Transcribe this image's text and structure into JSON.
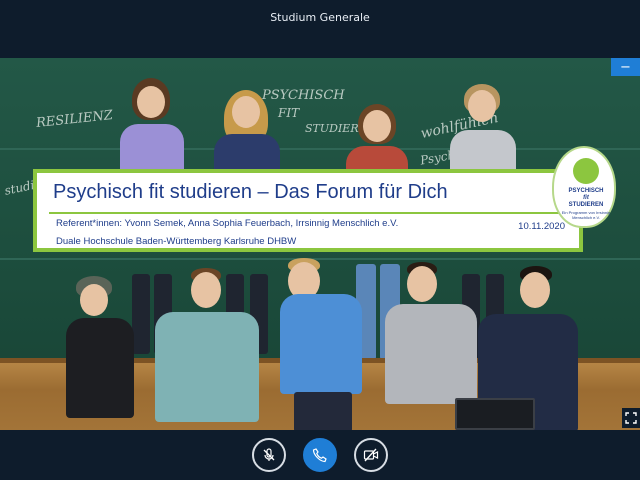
{
  "window": {
    "title": "Studium Generale"
  },
  "slide": {
    "title": "Psychisch fit studieren – Das Forum für Dich",
    "speakers": "Referent*innen: Yvonn Semek, Anna Sophia Feuerbach, Irrsinnig Menschlich e.V.",
    "date": "10.11.2020",
    "institution": "Duale Hochschule Baden-Württemberg Karlsruhe DHBW",
    "chalk_words": [
      "RESILIENZ",
      "PSYCHISCH",
      "FIT",
      "STUDIER",
      "wohlfühlen",
      "Psyche",
      "studieren",
      "fit"
    ],
    "logo": {
      "line1": "PSYCHISCH",
      "line2": "fit",
      "line3": "STUDIEREN",
      "line4": "Ein Programm von Irrsinnig Menschlich e.V."
    }
  },
  "controls": {
    "minimize_label": "−",
    "fullscreen_icon": "expand-icon",
    "mute_icon": "microphone-muted-icon",
    "call_icon": "phone-icon",
    "video_icon": "camera-off-icon"
  },
  "colors": {
    "accent_blue": "#1f7ed6",
    "banner_green": "#8cc63f",
    "banner_text": "#1f3d8a",
    "background": "#0e1c2c"
  }
}
